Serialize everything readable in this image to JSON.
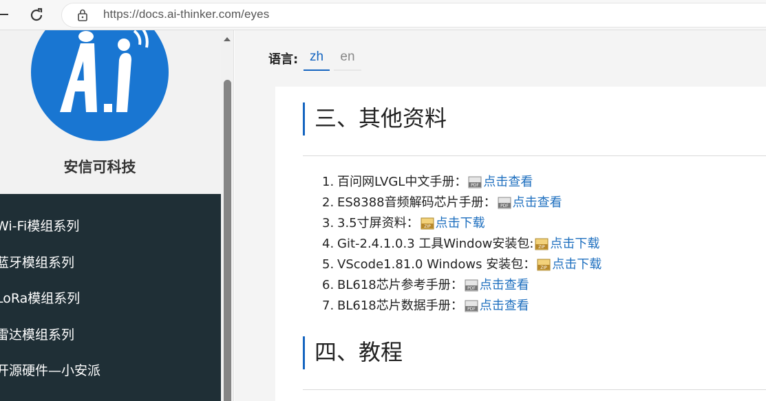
{
  "browser": {
    "url": "https://docs.ai-thinker.com/eyes"
  },
  "sidebar": {
    "brand": "安信可科技",
    "items": [
      {
        "label": "Wi-Fi模组系列"
      },
      {
        "label": "蓝牙模组系列"
      },
      {
        "label": "LoRa模组系列"
      },
      {
        "label": "雷达模组系列"
      },
      {
        "label": "开源硬件—小安派"
      }
    ]
  },
  "main": {
    "lang_label": "语言:",
    "tabs": [
      {
        "label": "zh",
        "active": true
      },
      {
        "label": "en",
        "active": false
      }
    ],
    "section3_title": "三、其他资料",
    "section4_title": "四、教程",
    "resources": [
      {
        "num": "1.",
        "text": "百问网LVGL中文手册：",
        "icon": "pdf-icon",
        "link": "点击查看"
      },
      {
        "num": "2.",
        "text": "ES8388音频解码芯片手册：",
        "icon": "pdf-icon",
        "link": "点击查看"
      },
      {
        "num": "3.",
        "text": "3.5寸屏资料：",
        "icon": "zip-icon",
        "link": "点击下载"
      },
      {
        "num": "4.",
        "text": "Git-2.4.1.0.3 工具Window安装包:",
        "icon": "zip-icon",
        "link": "点击下载"
      },
      {
        "num": "5.",
        "text": "VScode1.81.0 Windows 安装包：",
        "icon": "zip-icon",
        "link": "点击下载"
      },
      {
        "num": "6.",
        "text": "BL618芯片参考手册：",
        "icon": "pdf-icon",
        "link": "点击查看"
      },
      {
        "num": "7.",
        "text": "BL618芯片数据手册：",
        "icon": "pdf-icon",
        "link": "点击查看"
      }
    ]
  },
  "colors": {
    "accent": "#1565c0",
    "link": "#1e6fbf",
    "sidebar_nav_bg": "#1f2f36",
    "logo_blue": "#1976d2"
  }
}
